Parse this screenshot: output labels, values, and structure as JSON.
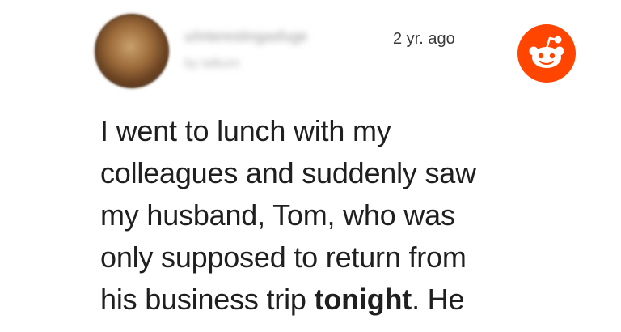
{
  "post": {
    "username": "u/interestingasfuge",
    "subline": "by talkum",
    "timestamp": "2 yr. ago",
    "platform_icon": "reddit-icon",
    "brand_color": "#FF4500",
    "lines": [
      "I went to lunch with my",
      "colleagues and suddenly saw",
      "my husband, Tom, who was",
      "only supposed to return from"
    ],
    "last_line_before": "his business trip ",
    "last_line_bold": "tonight",
    "last_line_after": ". He"
  }
}
